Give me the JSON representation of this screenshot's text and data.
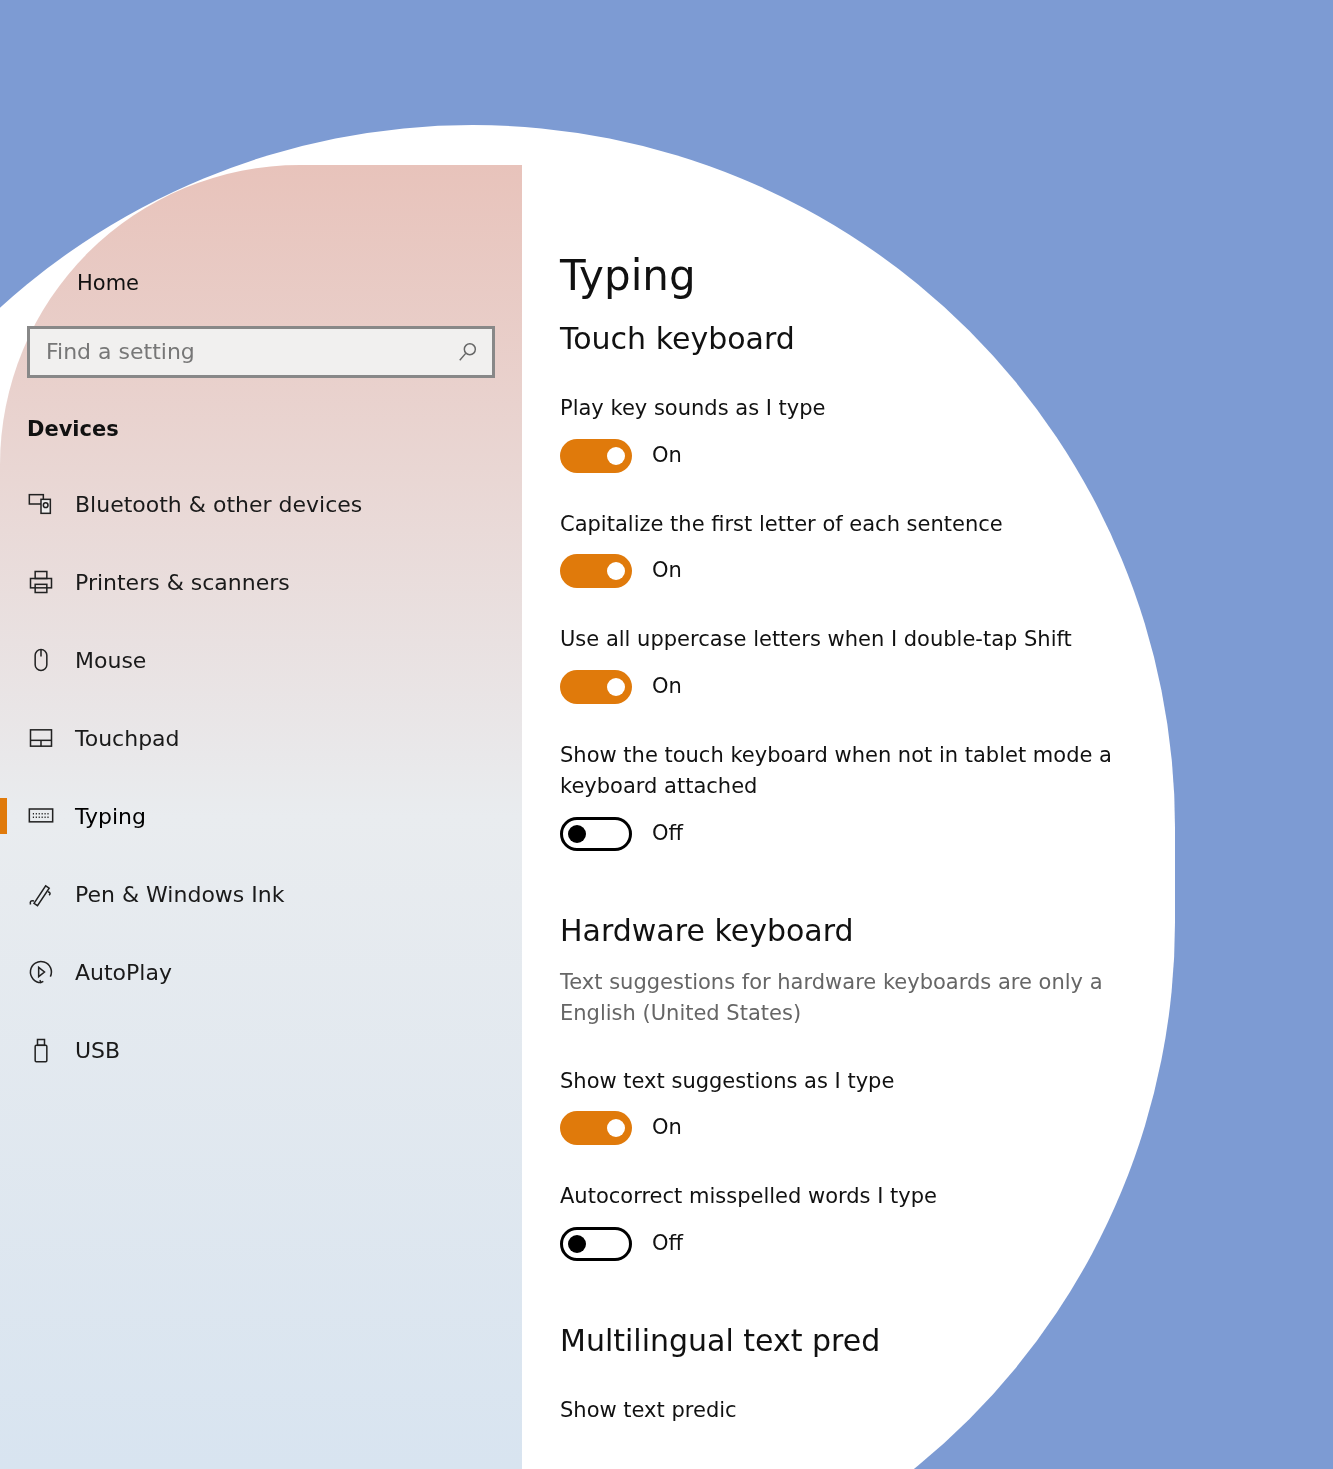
{
  "sidebar": {
    "home": "Home",
    "search": {
      "placeholder": "Find a setting"
    },
    "group": "Devices",
    "items": [
      {
        "label": "Bluetooth & other devices",
        "selected": false
      },
      {
        "label": "Printers & scanners",
        "selected": false
      },
      {
        "label": "Mouse",
        "selected": false
      },
      {
        "label": "Touchpad",
        "selected": false
      },
      {
        "label": "Typing",
        "selected": true
      },
      {
        "label": "Pen & Windows Ink",
        "selected": false
      },
      {
        "label": "AutoPlay",
        "selected": false
      },
      {
        "label": "USB",
        "selected": false
      }
    ]
  },
  "page": {
    "title": "Typing",
    "sections": [
      {
        "heading": "Touch keyboard",
        "settings": [
          {
            "kind": "toggle",
            "label": "Play key sounds as I type",
            "on": true,
            "state": "On"
          },
          {
            "kind": "toggle",
            "label": "Capitalize the first letter of each sentence",
            "on": true,
            "state": "On"
          },
          {
            "kind": "toggle",
            "label": "Use all uppercase letters when I double-tap Shift",
            "on": true,
            "state": "On"
          },
          {
            "kind": "toggle",
            "label": "Show the touch keyboard when not in tablet mode a",
            "label_2": "keyboard attached",
            "on": false,
            "state": "Off"
          }
        ]
      },
      {
        "heading": "Hardware keyboard",
        "settings": [
          {
            "kind": "note",
            "label": "Text suggestions for hardware keyboards are only a",
            "label_2": "English (United States)"
          },
          {
            "kind": "toggle",
            "label": "Show text suggestions as I type",
            "on": true,
            "state": "On"
          },
          {
            "kind": "toggle",
            "label": "Autocorrect misspelled words I type",
            "on": false,
            "state": "Off"
          }
        ]
      },
      {
        "heading": "Multilingual text pred",
        "settings": [
          {
            "kind": "text",
            "label": "Show text predic"
          }
        ]
      }
    ]
  }
}
